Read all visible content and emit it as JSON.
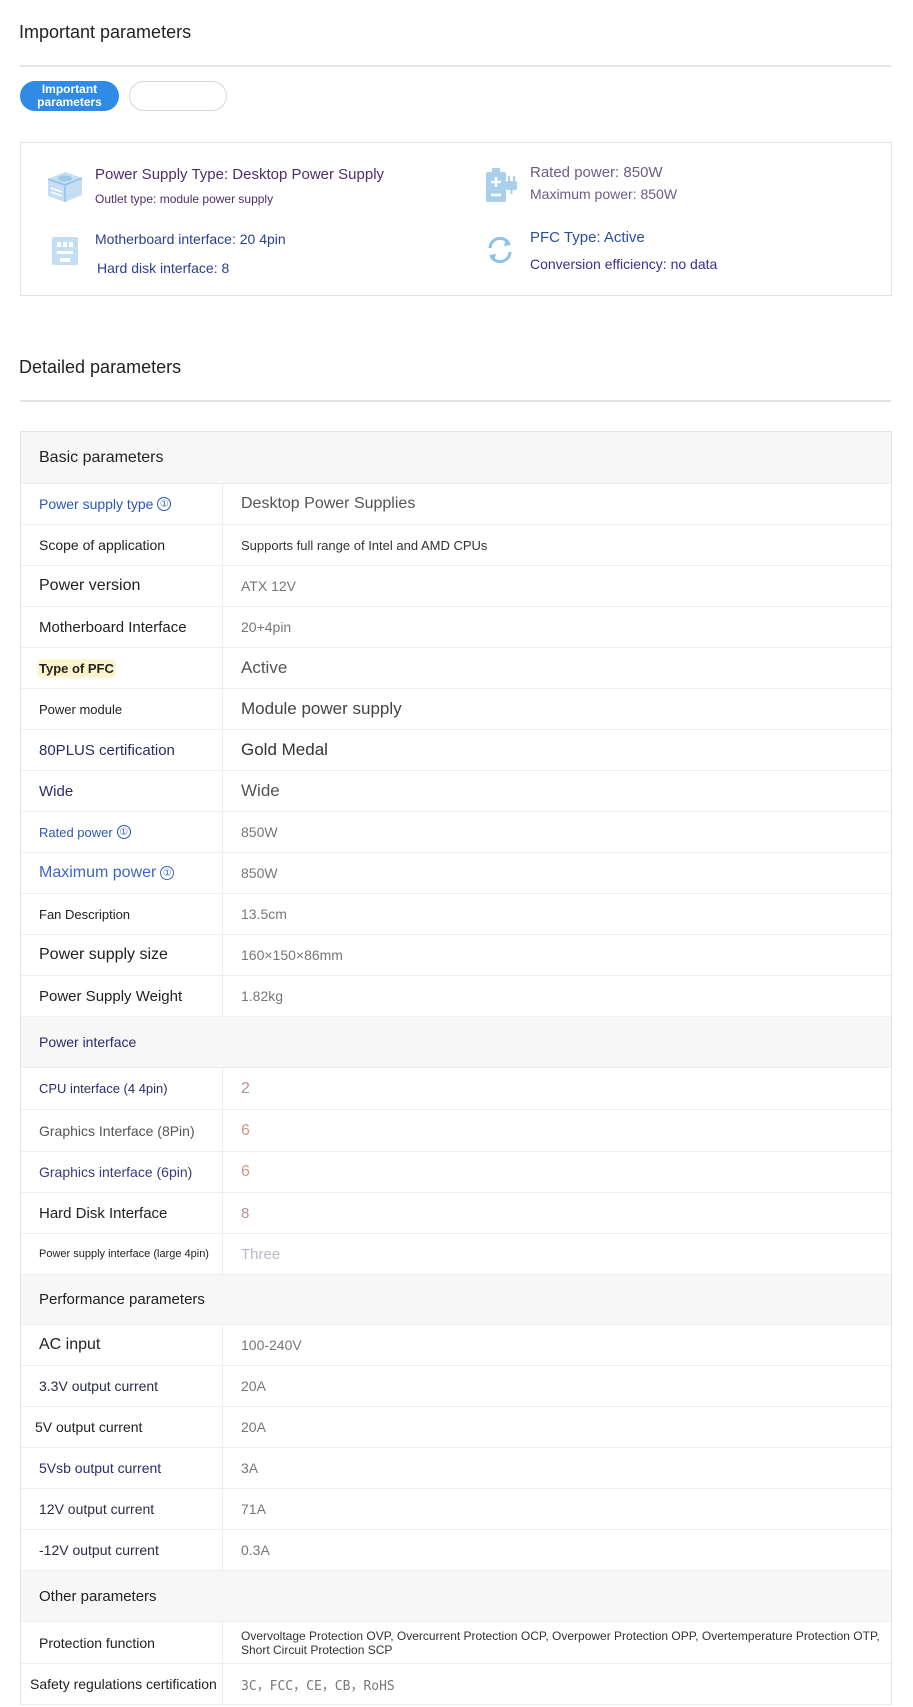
{
  "important": {
    "title": "Important parameters",
    "tabs": [
      {
        "label": "Important parameters",
        "active": true
      },
      {
        "label": "",
        "active": false
      }
    ],
    "items": [
      {
        "icon": "power-supply-icon",
        "line1": "Power Supply Type: Desktop Power Supply",
        "line2": "Outlet type: module power supply"
      },
      {
        "icon": "battery-plug-icon",
        "line1": "Rated power: 850W",
        "line2": "Maximum power: 850W"
      },
      {
        "icon": "motherboard-connector-icon",
        "line1": "Motherboard interface: 20 4pin",
        "line2": "Hard disk interface: 8"
      },
      {
        "icon": "refresh-cycle-icon",
        "line1": "PFC Type: Active",
        "line2": "Conversion efficiency: no data"
      }
    ],
    "accent_color": "#2f8be6",
    "icon_color": "#a9cfee"
  },
  "detailed": {
    "title": "Detailed parameters",
    "groups": [
      {
        "title": "Basic parameters",
        "rows": [
          {
            "label": "Power supply type",
            "value": "Desktop Power Supplies",
            "info": "①"
          },
          {
            "label": "Scope of application",
            "value": "Supports full range of Intel and AMD CPUs"
          },
          {
            "label": "Power version",
            "value": "ATX 12V"
          },
          {
            "label": "Motherboard Interface",
            "value": "20+4pin"
          },
          {
            "label": "Type of PFC",
            "value": "Active"
          },
          {
            "label": "Power module",
            "value": "Module power supply"
          },
          {
            "label": "80PLUS certification",
            "value": "Gold Medal"
          },
          {
            "label": "Wide",
            "value": "Wide"
          },
          {
            "label": "Rated power",
            "value": "850W",
            "info": "①"
          },
          {
            "label": "Maximum power",
            "value": "850W",
            "info": "①"
          },
          {
            "label": "Fan Description",
            "value": "13.5cm"
          },
          {
            "label": "Power supply size",
            "value": "160×150×86mm"
          },
          {
            "label": "Power Supply Weight",
            "value": "1.82kg"
          }
        ]
      },
      {
        "title": "Power interface",
        "rows": [
          {
            "label": "CPU interface (4 4pin)",
            "value": "2"
          },
          {
            "label": "Graphics Interface (8Pin)",
            "value": "6"
          },
          {
            "label": "Graphics interface (6pin)",
            "value": "6"
          },
          {
            "label": "Hard Disk Interface",
            "value": "8"
          },
          {
            "label": "Power supply interface (large 4pin)",
            "value": "Three"
          }
        ]
      },
      {
        "title": "Performance parameters",
        "rows": [
          {
            "label": "AC input",
            "value": "100-240V"
          },
          {
            "label": "3.3V output current",
            "value": "20A"
          },
          {
            "label": "5V output current",
            "value": "20A"
          },
          {
            "label": "5Vsb output current",
            "value": "3A"
          },
          {
            "label": "12V output current",
            "value": "71A"
          },
          {
            "label": "-12V output current",
            "value": "0.3A"
          }
        ]
      },
      {
        "title": "Other parameters",
        "rows": [
          {
            "label": "Protection function",
            "value": "Overvoltage Protection OVP, Overcurrent Protection OCP, Overpower Protection OPP, Overtemperature Protection OTP, Short Circuit Protection SCP"
          },
          {
            "label": "Safety regulations certification",
            "value": "3C，FCC，CE，CB，RoHS"
          }
        ]
      }
    ]
  }
}
